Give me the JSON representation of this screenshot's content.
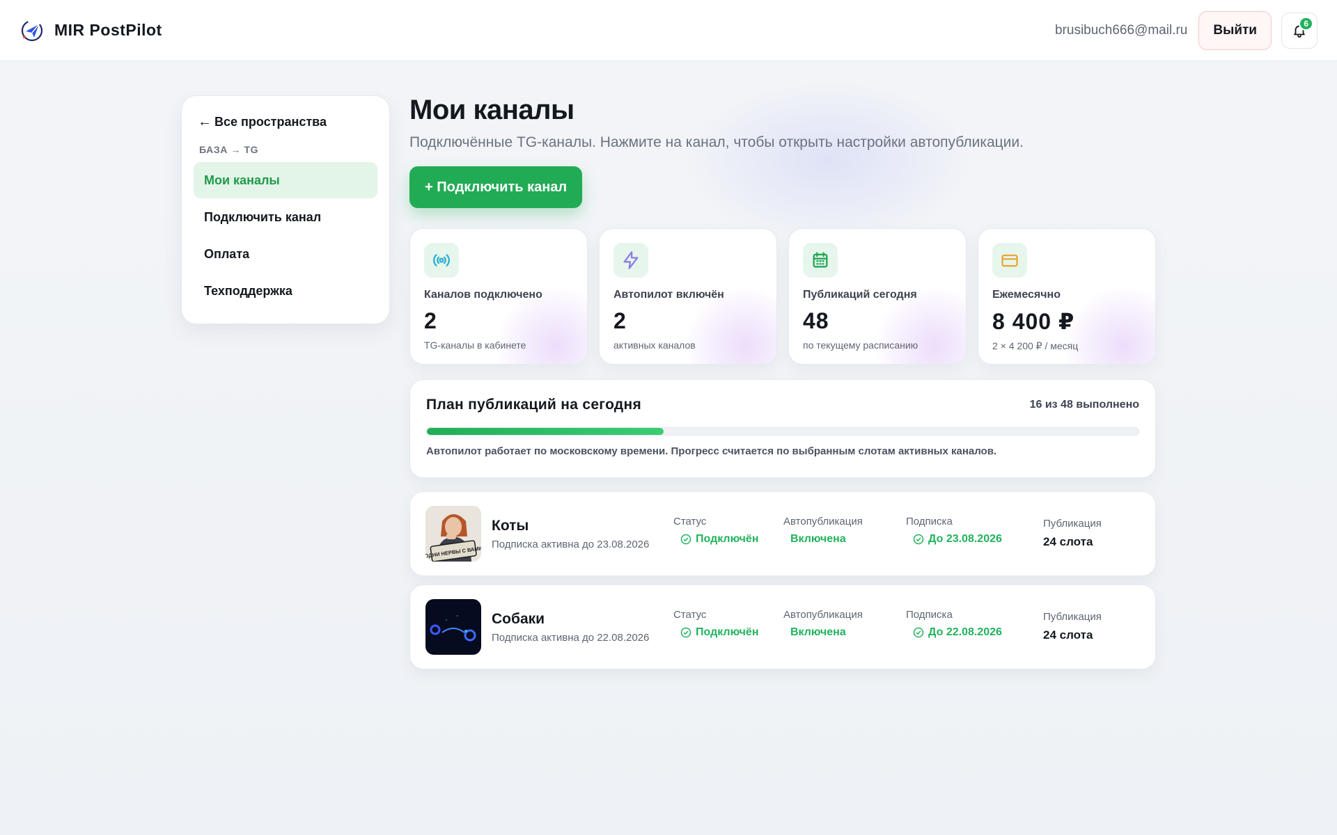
{
  "header": {
    "brand": "MIR PostPilot",
    "user_email": "brusibuch666@mail.ru",
    "logout_label": "Выйти",
    "notifications_count": "6"
  },
  "sidebar": {
    "back_label": "Все пространства",
    "caption": "БАЗА → TG",
    "items": [
      {
        "label": "Мои каналы",
        "active": true
      },
      {
        "label": "Подключить канал"
      },
      {
        "label": "Оплата"
      },
      {
        "label": "Техподдержка"
      }
    ]
  },
  "main": {
    "title": "Мои каналы",
    "subtitle": "Подключённые TG-каналы. Нажмите на канал, чтобы открыть настройки автопубликации.",
    "connect_button": "+ Подключить канал",
    "stats": [
      {
        "icon": "broadcast-icon",
        "label": "Каналов подключено",
        "value": "2",
        "sub": "TG-каналы в кабинете"
      },
      {
        "icon": "lightning-icon",
        "label": "Автопилот включён",
        "value": "2",
        "sub": "активных каналов"
      },
      {
        "icon": "calendar-icon",
        "label": "Публикаций сегодня",
        "value": "48",
        "sub": "по текущему расписанию"
      },
      {
        "icon": "credit-card-icon",
        "label": "Ежемесячно",
        "value": "8 400 ₽",
        "sub": "2 × 4 200 ₽ / месяц"
      }
    ],
    "plan": {
      "title": "План публикаций на сегодня",
      "progress_text": "16 из 48 выполнено",
      "progress_fraction": 0.333,
      "note": "Автопилот работает по московскому времени. Прогресс считается по выбранным слотам активных каналов."
    },
    "channel_columns": {
      "status": "Статус",
      "autopublish": "Автопубликация",
      "subscription": "Подписка",
      "publication": "Публикация"
    },
    "channels": [
      {
        "name": "Коты",
        "sub": "Подписка активна до 23.08.2026",
        "avatar_caption": "ОДНИ НЕРВЫ С ВАМИ",
        "status": "Подключён",
        "autopublish": "Включена",
        "subscription": "До 23.08.2026",
        "publication": "24 слота"
      },
      {
        "name": "Собаки",
        "sub": "Подписка активна до 22.08.2026",
        "status": "Подключён",
        "autopublish": "Включена",
        "subscription": "До 22.08.2026",
        "publication": "24 слота"
      }
    ]
  },
  "colors": {
    "accent_green": "#22ab55",
    "active_nav_bg": "#e3f4e8",
    "icon_broadcast": "#2bb0d6",
    "icon_lightning": "#8b7fe3",
    "icon_calendar": "#22a653",
    "icon_card": "#e9a53a"
  }
}
